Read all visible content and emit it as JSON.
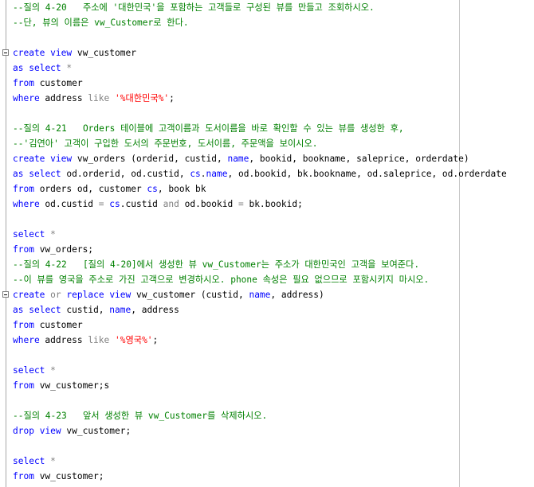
{
  "editor": {
    "lines": [
      [
        {
          "t": "--질의 4-20   주소에 '대한민국'을 포함하는 고객들로 구성된 뷰를 만들고 조회하시오.",
          "c": "cm"
        }
      ],
      [
        {
          "t": "--단, 뷰의 이름은 vw_Customer로 한다.",
          "c": "cm"
        }
      ],
      [],
      [
        {
          "t": "create",
          "c": "kw"
        },
        {
          "t": " ",
          "c": "id"
        },
        {
          "t": "view",
          "c": "kw"
        },
        {
          "t": " vw_customer",
          "c": "id"
        }
      ],
      [
        {
          "t": "as",
          "c": "kw"
        },
        {
          "t": " ",
          "c": "id"
        },
        {
          "t": "select",
          "c": "kw"
        },
        {
          "t": " ",
          "c": "id"
        },
        {
          "t": "*",
          "c": "op"
        }
      ],
      [
        {
          "t": "from",
          "c": "kw"
        },
        {
          "t": " customer",
          "c": "id"
        }
      ],
      [
        {
          "t": "where",
          "c": "kw"
        },
        {
          "t": " address ",
          "c": "id"
        },
        {
          "t": "like",
          "c": "op"
        },
        {
          "t": " ",
          "c": "id"
        },
        {
          "t": "'%대한민국%'",
          "c": "str"
        },
        {
          "t": ";",
          "c": "id"
        }
      ],
      [],
      [
        {
          "t": "--질의 4-21   Orders 테이블에 고객이름과 도서이름을 바로 확인할 수 있는 뷰를 생성한 후,",
          "c": "cm"
        }
      ],
      [
        {
          "t": "--'김연아' 고객이 구입한 도서의 주문번호, 도서이름, 주문액을 보이시오.",
          "c": "cm"
        }
      ],
      [
        {
          "t": "create",
          "c": "kw"
        },
        {
          "t": " ",
          "c": "id"
        },
        {
          "t": "view",
          "c": "kw"
        },
        {
          "t": " vw_orders (orderid, custid, ",
          "c": "id"
        },
        {
          "t": "name",
          "c": "kw"
        },
        {
          "t": ", bookid, bookname, saleprice, orderdate)",
          "c": "id"
        }
      ],
      [
        {
          "t": "as",
          "c": "kw"
        },
        {
          "t": " ",
          "c": "id"
        },
        {
          "t": "select",
          "c": "kw"
        },
        {
          "t": " od.orderid, od.custid, ",
          "c": "id"
        },
        {
          "t": "cs",
          "c": "kw"
        },
        {
          "t": ".",
          "c": "id"
        },
        {
          "t": "name",
          "c": "kw"
        },
        {
          "t": ", od.bookid, bk.bookname, od.saleprice, od.orderdate",
          "c": "id"
        }
      ],
      [
        {
          "t": "from",
          "c": "kw"
        },
        {
          "t": " orders od, customer ",
          "c": "id"
        },
        {
          "t": "cs",
          "c": "kw"
        },
        {
          "t": ", book bk",
          "c": "id"
        }
      ],
      [
        {
          "t": "where",
          "c": "kw"
        },
        {
          "t": " od.custid ",
          "c": "id"
        },
        {
          "t": "=",
          "c": "op"
        },
        {
          "t": " ",
          "c": "id"
        },
        {
          "t": "cs",
          "c": "kw"
        },
        {
          "t": ".custid ",
          "c": "id"
        },
        {
          "t": "and",
          "c": "op"
        },
        {
          "t": " od.bookid ",
          "c": "id"
        },
        {
          "t": "=",
          "c": "op"
        },
        {
          "t": " bk.bookid;",
          "c": "id"
        }
      ],
      [],
      [
        {
          "t": "select",
          "c": "kw"
        },
        {
          "t": " ",
          "c": "id"
        },
        {
          "t": "*",
          "c": "op"
        }
      ],
      [
        {
          "t": "from",
          "c": "kw"
        },
        {
          "t": " vw_orders;",
          "c": "id"
        }
      ],
      [
        {
          "t": "--질의 4-22   [질의 4-20]에서 생성한 뷰 vw_Customer는 주소가 대한민국인 고객을 보여준다.",
          "c": "cm"
        }
      ],
      [
        {
          "t": "--이 뷰를 영국을 주소로 가진 고객으로 변경하시오. phone 속성은 필요 없으므로 포함시키지 마시오.",
          "c": "cm"
        }
      ],
      [
        {
          "t": "create",
          "c": "kw"
        },
        {
          "t": " ",
          "c": "id"
        },
        {
          "t": "or",
          "c": "op"
        },
        {
          "t": " ",
          "c": "id"
        },
        {
          "t": "replace",
          "c": "kw"
        },
        {
          "t": " ",
          "c": "id"
        },
        {
          "t": "view",
          "c": "kw"
        },
        {
          "t": " vw_customer (custid, ",
          "c": "id"
        },
        {
          "t": "name",
          "c": "kw"
        },
        {
          "t": ", address)",
          "c": "id"
        }
      ],
      [
        {
          "t": "as",
          "c": "kw"
        },
        {
          "t": " ",
          "c": "id"
        },
        {
          "t": "select",
          "c": "kw"
        },
        {
          "t": " custid, ",
          "c": "id"
        },
        {
          "t": "name",
          "c": "kw"
        },
        {
          "t": ", address",
          "c": "id"
        }
      ],
      [
        {
          "t": "from",
          "c": "kw"
        },
        {
          "t": " customer",
          "c": "id"
        }
      ],
      [
        {
          "t": "where",
          "c": "kw"
        },
        {
          "t": " address ",
          "c": "id"
        },
        {
          "t": "like",
          "c": "op"
        },
        {
          "t": " ",
          "c": "id"
        },
        {
          "t": "'%영국%'",
          "c": "str"
        },
        {
          "t": ";",
          "c": "id"
        }
      ],
      [],
      [
        {
          "t": "select",
          "c": "kw"
        },
        {
          "t": " ",
          "c": "id"
        },
        {
          "t": "*",
          "c": "op"
        }
      ],
      [
        {
          "t": "from",
          "c": "kw"
        },
        {
          "t": " vw_customer;s",
          "c": "id"
        }
      ],
      [],
      [
        {
          "t": "--질의 4-23   앞서 생성한 뷰 vw_Customer를 삭제하시오.",
          "c": "cm"
        }
      ],
      [
        {
          "t": "drop",
          "c": "kw"
        },
        {
          "t": " ",
          "c": "id"
        },
        {
          "t": "view",
          "c": "kw"
        },
        {
          "t": " vw_customer;",
          "c": "id"
        }
      ],
      [],
      [
        {
          "t": "select",
          "c": "kw"
        },
        {
          "t": " ",
          "c": "id"
        },
        {
          "t": "*",
          "c": "op"
        }
      ],
      [
        {
          "t": "from",
          "c": "kw"
        },
        {
          "t": " vw_customer;",
          "c": "id"
        }
      ]
    ],
    "fold_markers_at_lines": [
      3,
      19
    ],
    "colors": {
      "keyword": "#0000ff",
      "comment": "#008000",
      "string": "#ff0000",
      "operator": "#808080",
      "identifier": "#000000",
      "background": "#ffffff"
    }
  }
}
